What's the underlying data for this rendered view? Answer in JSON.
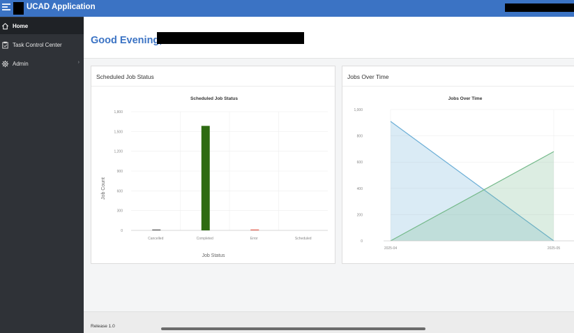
{
  "header": {
    "app_title": "UCAD Application",
    "menu_icon": "hamburger-menu-icon",
    "bar_color": "#3b73c4"
  },
  "sidebar": {
    "items": [
      {
        "label": "Home",
        "icon": "home-icon",
        "active": true
      },
      {
        "label": "Task Control Center",
        "icon": "task-clipboard-icon",
        "active": false
      },
      {
        "label": "Admin",
        "icon": "gear-icon",
        "active": false,
        "expandable": true
      }
    ]
  },
  "greeting": {
    "text": "Good Evening,"
  },
  "cards": {
    "job_status": {
      "header": "Scheduled Job Status",
      "chart_data": {
        "type": "bar",
        "title": "Scheduled Job Status",
        "xlabel": "Job Status",
        "ylabel": "Job Count",
        "categories": [
          "Cancelled",
          "Completed",
          "Error",
          "Scheduled"
        ],
        "values": [
          10,
          1585,
          8,
          0
        ],
        "colors": [
          "#555555",
          "#2e6b12",
          "#e05a4a",
          "#999999"
        ],
        "yticks": [
          "1,800",
          "1,500",
          "1,200",
          "900",
          "600",
          "300",
          "0"
        ],
        "ylim": [
          0,
          1800
        ],
        "grid": true
      }
    },
    "jobs_over_time": {
      "header": "Jobs Over Time",
      "chart_data": {
        "type": "area",
        "title": "Jobs Over Time",
        "x": [
          "2025-04",
          "2025-05"
        ],
        "series": [
          {
            "values": [
              910,
              0
            ],
            "color": "#6baed6"
          },
          {
            "values": [
              0,
              680
            ],
            "color": "#74b98a"
          }
        ],
        "yticks": [
          "1,000",
          "800",
          "600",
          "400",
          "200",
          "0"
        ],
        "ylim": [
          0,
          1000
        ],
        "grid": true
      }
    }
  },
  "footer": {
    "release": "Release 1.0"
  }
}
